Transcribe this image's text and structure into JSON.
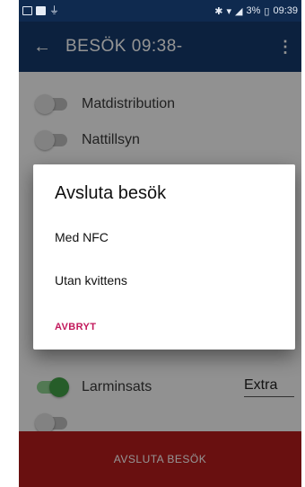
{
  "status_bar": {
    "battery": "3%",
    "time": "09:39"
  },
  "app_bar": {
    "back_icon": "arrow-left-icon",
    "title": "BESÖK 09:38-",
    "menu_icon": "more-vert-icon"
  },
  "list": {
    "items": [
      {
        "label": "Matdistribution",
        "on": false
      },
      {
        "label": "Nattillsyn",
        "on": false
      },
      {
        "label": "Larminsats",
        "on": true,
        "extra": "Extra"
      }
    ]
  },
  "dialog": {
    "title": "Avsluta besök",
    "options": [
      "Med NFC",
      "Utan kvittens"
    ],
    "cancel": "AVBRYT"
  },
  "bottom_bar": {
    "label": "AVSLUTA BESÖK"
  },
  "colors": {
    "app_bar": "#153a6b",
    "status_bar": "#0f2a4f",
    "bottom_bar": "#b51c1c",
    "accent": "#c2185b",
    "switch_on": "#43a047"
  }
}
